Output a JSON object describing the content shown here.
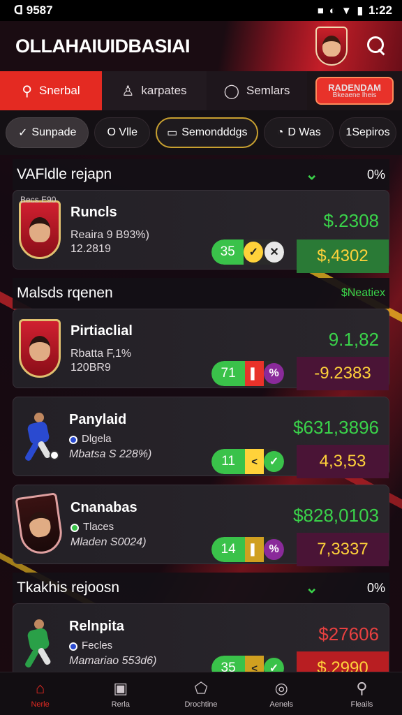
{
  "status": {
    "time_left": "ᗡ 9587",
    "time_right": "1:22"
  },
  "header": {
    "title": "OLLAHAIUIDBASIAI"
  },
  "tabs": [
    {
      "label": "Snerbal",
      "icon": "search"
    },
    {
      "label": "karpates",
      "icon": "shirt"
    },
    {
      "label": "Semlars",
      "icon": "chat"
    }
  ],
  "promo": {
    "line1": "RADENDAM",
    "line2": "Bkeaene lheis"
  },
  "filters": [
    {
      "label": "Sunpade"
    },
    {
      "label": "O Vlle"
    },
    {
      "label": "Semondddgs"
    },
    {
      "label": "D Was"
    },
    {
      "label": "1Sepiros"
    }
  ],
  "sections": [
    {
      "title": "VAFldle rejapn",
      "right": "0%",
      "cards": [
        {
          "tag": "Becs E90",
          "name": "Runcls",
          "sub1": "Reaira 9 B93%)",
          "sub2": "12.2819",
          "price_top": "$.2308",
          "num": "35",
          "price_box": "$,4302"
        }
      ]
    },
    {
      "title": "Malsds rqenen",
      "right": "$Neatiex",
      "cards": [
        {
          "name": "Pirtiaclial",
          "sub1": "Rbatta F,1%",
          "sub2": "120BR9",
          "price_top": "9.1,82",
          "num": "71",
          "price_box": "-9.2383"
        },
        {
          "name": "Panylaid",
          "sub1": "Dlgela",
          "sub2": "Mbatsa S 228%)",
          "price_top": "$631,3896",
          "num": "11",
          "price_box": "4,3,53"
        },
        {
          "name": "Cnanabas",
          "sub1": "Tlaces",
          "sub2": "Mladen S0024)",
          "price_top": "$828,0103",
          "num": "14",
          "price_box": "7,3337"
        }
      ]
    },
    {
      "title": "Tkakhis rejoosn",
      "right": "0%",
      "cards": [
        {
          "name": "Relnpita",
          "sub1": "Fecles",
          "sub2": "Mamariao 553d6)",
          "price_top": "$27606",
          "num": "35",
          "price_box": "$,2990"
        }
      ]
    }
  ],
  "nav": [
    {
      "label": "Nerle"
    },
    {
      "label": "Rerla"
    },
    {
      "label": "Drochtine"
    },
    {
      "label": "Aenels"
    },
    {
      "label": "Fleails"
    }
  ],
  "colors": {
    "accent": "#e42a22",
    "positive": "#3ad24a",
    "negative": "#e84040",
    "gold": "#ffd23a"
  }
}
